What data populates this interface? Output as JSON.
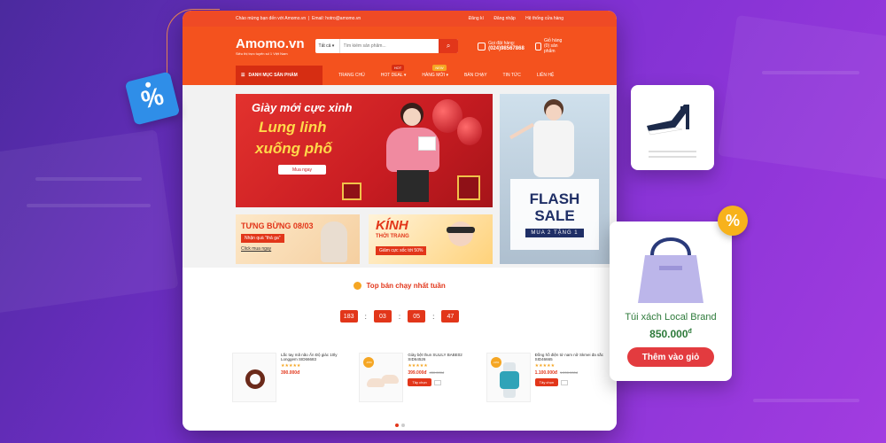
{
  "site": {
    "top_welcome": "Chào mừng bạn đến với Amomo.vn",
    "top_email": "Email: hotro@amomo.vn",
    "top_links": [
      "Đăng kí",
      "Đăng nhập",
      "Hệ thống cửa hàng"
    ],
    "logo": "Amomo.vn",
    "logo_tagline": "Siêu thị trực tuyến số 1 Việt Nam",
    "search_category": "Tất cả",
    "search_placeholder": "Tìm kiếm sản phẩm...",
    "hotline_label": "Gọi đặt hàng:",
    "hotline_number": "(024)98567868",
    "cart_label": "Giỏ hàng",
    "cart_count": "(0) sản phẩm",
    "cart_badge": "0"
  },
  "nav": {
    "category_button": "DANH MỤC SẢN PHẨM",
    "items": [
      "TRANG CHỦ",
      "HOT DEAL",
      "HÀNG MỚI",
      "BÁN CHẠY",
      "TIN TỨC",
      "LIÊN HỆ"
    ],
    "hot_badge": "HOT",
    "new_badge": "NEW"
  },
  "banners": {
    "main_line1": "Giày mới cực xinh",
    "main_line2": "Lung linh",
    "main_line3": "xuống phố",
    "main_cta": "Mua ngay",
    "small1_title": "TƯNG BỪNG 08/03",
    "small1_promo": "Nhận quà \"thả ga\"",
    "small1_link": "Click mua ngay",
    "small2_title": "KÍNH",
    "small2_sub": "THỜI TRANG",
    "small2_promo": "Giảm cực sốc tới 50%",
    "flash_line1": "FLASH",
    "flash_line2": "SALE",
    "flash_promo": "MUA 2 TẶNG 1"
  },
  "bestseller": {
    "title": "Top bán chạy nhất tuần",
    "timer": [
      "183",
      "03",
      "05",
      "47"
    ],
    "products": [
      {
        "name": "Lắc tay mã não Ấn Độ giác 10ly Longgem SID66683",
        "stars": "★★★★★",
        "price": "390.000đ",
        "old_price": "",
        "buy": "",
        "sale": ""
      },
      {
        "name": "Giày bệt thun SULILY BABE02 SID64526",
        "stars": "★★★★★",
        "price": "399.000đ",
        "old_price": "450.000đ",
        "buy": "Tây chọn",
        "sale": "-15%"
      },
      {
        "name": "Đồng hồ điện tử nam nữ Skmei đa sắc SID46665",
        "stars": "★★★★★",
        "price": "1.100.000đ",
        "old_price": "1.200.000đ",
        "buy": "Tây chọn",
        "sale": "-10%"
      }
    ]
  },
  "overlay": {
    "tag_symbol": "%",
    "badge_symbol": "%",
    "bag_name": "Túi xách Local Brand",
    "bag_price": "850.000",
    "bag_currency": "đ",
    "add_to_cart": "Thêm vào giỏ"
  },
  "colors": {
    "brand_orange": "#f4521e",
    "accent_red": "#e2361a",
    "background_purple": "#7a2fd0",
    "flash_navy": "#1f2f66",
    "add_button": "#e33b3f",
    "price_green": "#2d7a3a"
  }
}
